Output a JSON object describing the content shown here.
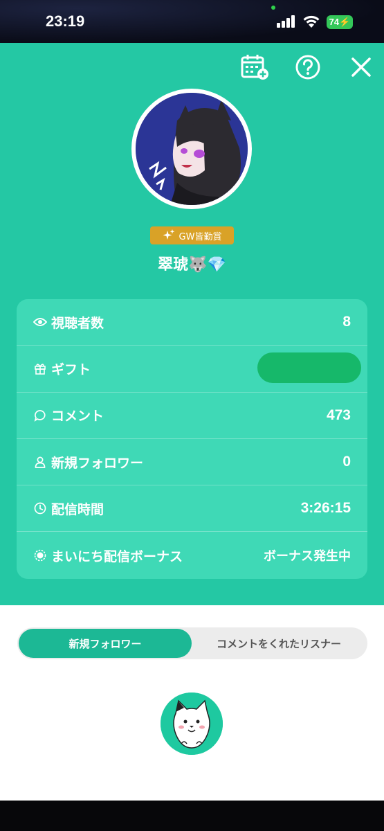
{
  "status_bar": {
    "time": "23:19",
    "battery": "74"
  },
  "header": {
    "calendar_icon": "calendar-add-icon",
    "help_icon": "help-icon",
    "close_icon": "close-icon"
  },
  "profile": {
    "badge": "GW皆勤賞",
    "name": "翠琥🐺💎"
  },
  "stats": {
    "viewers_label": "視聴者数",
    "viewers_value": "8",
    "gift_label": "ギフト",
    "comment_label": "コメント",
    "comment_value": "473",
    "new_followers_label": "新規フォロワー",
    "new_followers_value": "0",
    "stream_time_label": "配信時間",
    "stream_time_value": "3:26:15",
    "daily_bonus_label": "まいにち配信ボーナス",
    "daily_bonus_value": "ボーナス発生中"
  },
  "tabs": {
    "new_followers": "新規フォロワー",
    "commenters": "コメントをくれたリスナー"
  },
  "colors": {
    "panel": "#24c8a4",
    "stats_card": "#3fd9b6",
    "badge": "#d9a227",
    "active_tab": "#1cb895"
  }
}
